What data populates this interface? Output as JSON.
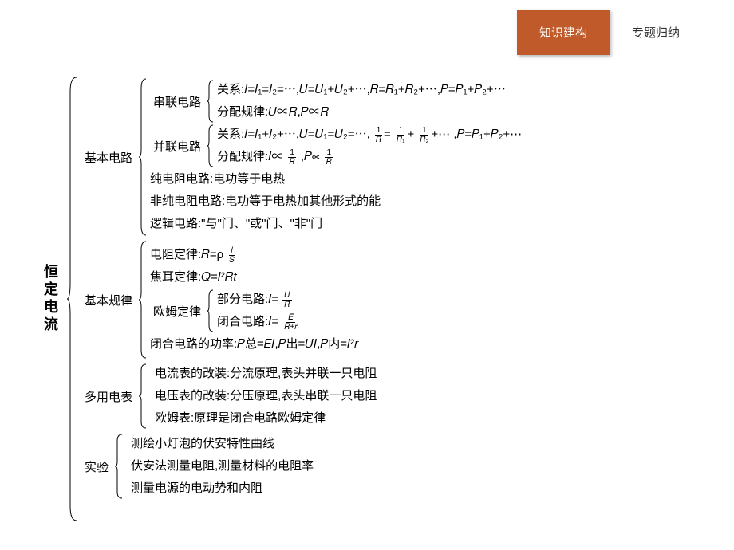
{
  "tabs": {
    "active": "知识建构",
    "inactive": "专题归纳"
  },
  "root": "恒定电流",
  "basic_circuit": {
    "label": "基本电路",
    "series": {
      "label": "串联电路",
      "rel": "关系:𝐼=𝐼₁=𝐼₂=⋯,𝑈=𝑈₁+𝑈₂+⋯,𝑅=𝑅₁+𝑅₂+⋯,𝑃=𝑃₁+𝑃₂+⋯",
      "dist": "分配规律:𝑈∝𝑅,𝑃∝𝑅"
    },
    "parallel": {
      "label": "并联电路",
      "rel": "关系:𝐼=𝐼₁+𝐼₂+⋯,𝑈=𝑈₁=𝑈₂=⋯,",
      "rel_frac": "1/𝑅=1/𝑅₁+1/𝑅₂+⋯",
      "rel_tail": ",𝑃=𝑃₁+𝑃₂+⋯",
      "dist": "分配规律:𝐼∝",
      "dist_f1n": "1",
      "dist_f1d": "𝑅",
      "dist_mid": ",𝑃∝",
      "dist_f2n": "1",
      "dist_f2d": "𝑅"
    },
    "pure": "纯电阻电路:电功等于电热",
    "nonpure": "非纯电阻电路:电功等于电热加其他形式的能",
    "logic": "逻辑电路:\"与\"门、\"或\"门、\"非\"门"
  },
  "basic_law": {
    "label": "基本规律",
    "resist": "电阻定律:𝑅=ρ",
    "resist_fn": "𝑙",
    "resist_fd": "𝑆",
    "joule": "焦耳定律:𝑄=𝐼²𝑅𝑡",
    "ohm": {
      "label": "欧姆定律",
      "part": "部分电路:𝐼=",
      "part_fn": "𝑈",
      "part_fd": "𝑅",
      "closed": "闭合电路:𝐼=",
      "closed_fn": "𝐸",
      "closed_fd": "𝑅+𝑟"
    },
    "power": "闭合电路的功率:𝑃总=𝐸𝐼,𝑃出=𝑈𝐼,𝑃内=𝐼²𝑟"
  },
  "multimeter": {
    "label": "多用电表",
    "ammeter": "电流表的改装:分流原理,表头并联一只电阻",
    "voltmeter": "电压表的改装:分压原理,表头串联一只电阻",
    "ohmmeter": "欧姆表:原理是闭合电路欧姆定律"
  },
  "experiment": {
    "label": "实验",
    "bulb": "测绘小灯泡的伏安特性曲线",
    "va": "伏安法测量电阻,测量材料的电阻率",
    "emf": "测量电源的电动势和内阻"
  }
}
